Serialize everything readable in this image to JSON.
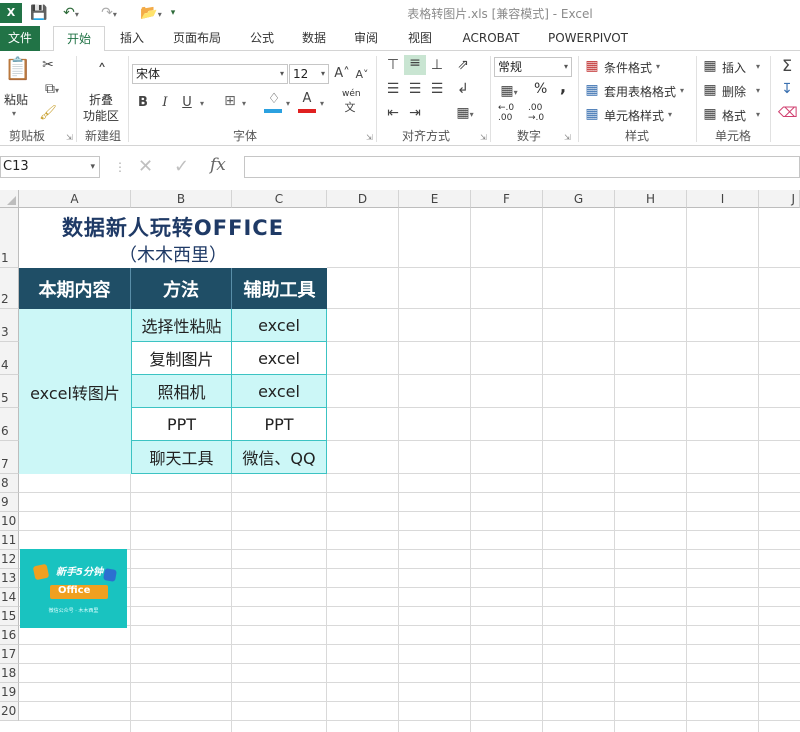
{
  "window": {
    "title": "表格转图片.xls  [兼容模式] - Excel",
    "app_icon": "excel-icon"
  },
  "ribbon_tabs": [
    "文件",
    "开始",
    "插入",
    "页面布局",
    "公式",
    "数据",
    "审阅",
    "视图",
    "ACROBAT",
    "POWERPIVOT"
  ],
  "active_tab": "开始",
  "ribbon": {
    "clipboard": {
      "label": "剪贴板",
      "paste": "粘贴"
    },
    "new_group": {
      "label": "新建组",
      "collapse": "折叠",
      "collapse2": "功能区"
    },
    "font": {
      "label": "字体",
      "font_name": "宋体",
      "font_size": "12",
      "bold": "B",
      "italic": "I",
      "underline": "U",
      "grow": "A",
      "shrink": "A",
      "pinyin": "wén"
    },
    "alignment": {
      "label": "对齐方式"
    },
    "number": {
      "label": "数字",
      "format": "常规",
      "percent": "%",
      "comma": ","
    },
    "styles": {
      "label": "样式",
      "conditional": "条件格式",
      "table_format": "套用表格格式",
      "cell_styles": "单元格样式"
    },
    "cells": {
      "label": "单元格",
      "insert": "插入",
      "delete": "删除",
      "format": "格式"
    }
  },
  "formula_bar": {
    "name_box": "C13",
    "fx": "fx",
    "value": ""
  },
  "columns": [
    "A",
    "B",
    "C",
    "D",
    "E",
    "F",
    "G",
    "H",
    "I",
    "J"
  ],
  "rows": [
    "1",
    "2",
    "3",
    "4",
    "5",
    "6",
    "7",
    "8",
    "9",
    "10",
    "11",
    "12",
    "13",
    "14",
    "15",
    "16",
    "17",
    "18",
    "19",
    "20"
  ],
  "sheet": {
    "title": "数据新人玩转OFFICE",
    "subtitle": "（木木西里）",
    "headers": [
      "本期内容",
      "方法",
      "辅助工具"
    ],
    "merged_a": "excel转图片",
    "rows": [
      [
        "选择性粘贴",
        "excel"
      ],
      [
        "复制图片",
        "excel"
      ],
      [
        "照相机",
        "excel"
      ],
      [
        "PPT",
        "PPT"
      ],
      [
        "聊天工具",
        "微信、QQ"
      ]
    ]
  },
  "image_badge": {
    "line1": "新手5分钟",
    "line2": "Office",
    "footer": "微信公众号 · 木木西里"
  },
  "colors": {
    "excel_green": "#217346",
    "header_bg": "#1f4e66",
    "data_bg": "#ccf7f7",
    "data_border": "#3cc3c3",
    "title_color": "#1f3a66",
    "badge_bg": "#19c3c0"
  }
}
